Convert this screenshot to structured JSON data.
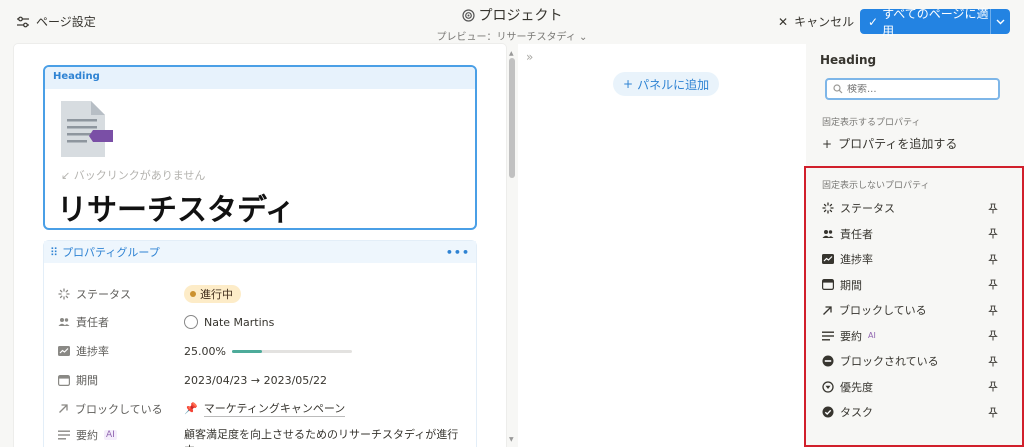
{
  "topbar": {
    "page_settings_label": "ページ設定",
    "title": "プロジェクト",
    "subtitle": "プレビュー：リサーチスタディ",
    "cancel_label": "キャンセル",
    "apply_label": "すべてのページに適用"
  },
  "preview": {
    "heading_label": "Heading",
    "backlink_text": "バックリンクがありません",
    "page_title": "リサーチスタディ",
    "group_label": "プロパティグループ",
    "properties": {
      "status": {
        "name": "ステータス",
        "value": "進行中"
      },
      "assignee": {
        "name": "責任者",
        "value": "Nate Martins"
      },
      "progress": {
        "name": "進捗率",
        "value": "25.00%",
        "fraction": 0.25
      },
      "period": {
        "name": "期間",
        "value": "2023/04/23 → 2023/05/22"
      },
      "blocking": {
        "name": "ブロックしている",
        "value": "マーケティングキャンペーン"
      },
      "summary": {
        "name": "要約",
        "ai": "AI",
        "value": "顧客満足度を向上させるためのリサーチスタディが進行中"
      }
    }
  },
  "middle": {
    "add_panel_label": "パネルに追加"
  },
  "sidebar": {
    "heading": "Heading",
    "search_placeholder": "検索...",
    "pinned_section": "固定表示するプロパティ",
    "add_property": "プロパティを追加する",
    "unpinned_section": "固定表示しないプロパティ",
    "items": [
      {
        "label": "ステータス",
        "icon": "status-icon"
      },
      {
        "label": "責任者",
        "icon": "people-icon"
      },
      {
        "label": "進捗率",
        "icon": "progress-icon"
      },
      {
        "label": "期間",
        "icon": "calendar-icon"
      },
      {
        "label": "ブロックしている",
        "icon": "arrow-up-right-icon"
      },
      {
        "label": "要約",
        "icon": "text-lines-icon",
        "badge": "AI"
      },
      {
        "label": "ブロックされている",
        "icon": "blocked-icon"
      },
      {
        "label": "優先度",
        "icon": "priority-icon"
      },
      {
        "label": "タスク",
        "icon": "check-circle-icon"
      }
    ]
  },
  "colors": {
    "accent": "#2383e2",
    "highlight_box": "#d11f2b",
    "status_chip_bg": "#fdecc8",
    "progress_fill": "#4dab9a"
  }
}
